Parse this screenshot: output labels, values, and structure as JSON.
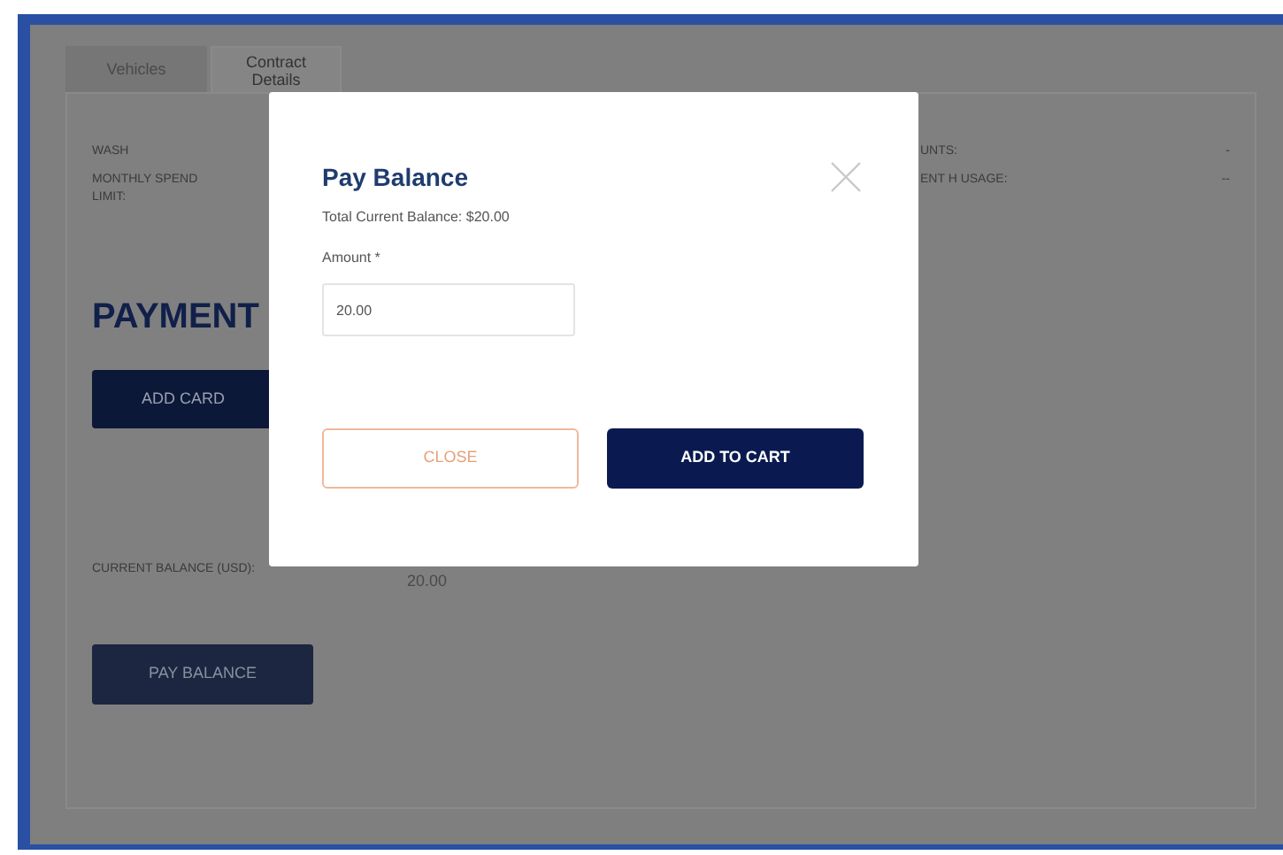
{
  "tabs": [
    {
      "label": "Vehicles",
      "selected": false
    },
    {
      "label": "Contract Details",
      "selected": true
    }
  ],
  "fields_left": [
    {
      "label": "WASH"
    },
    {
      "label": "MONTHLY SPEND LIMIT:"
    }
  ],
  "fields_right": [
    {
      "label": "UNTS:",
      "value": "-"
    },
    {
      "label": "ENT H USAGE:",
      "value": "--"
    }
  ],
  "payment": {
    "heading": "PAYMENT",
    "add_card": "ADD CARD",
    "balance_label": "CURRENT BALANCE (USD):",
    "balance_value": "20.00",
    "pay_button": "PAY BALANCE"
  },
  "dialog": {
    "title": "Pay Balance",
    "subtitle": "Total Current Balance: $20.00",
    "amount_label": "Amount *",
    "amount_value": "20.00",
    "buttons": [
      {
        "label": "CLOSE",
        "kind": "secondary"
      },
      {
        "label": "ADD TO CART",
        "kind": "primary"
      }
    ]
  }
}
